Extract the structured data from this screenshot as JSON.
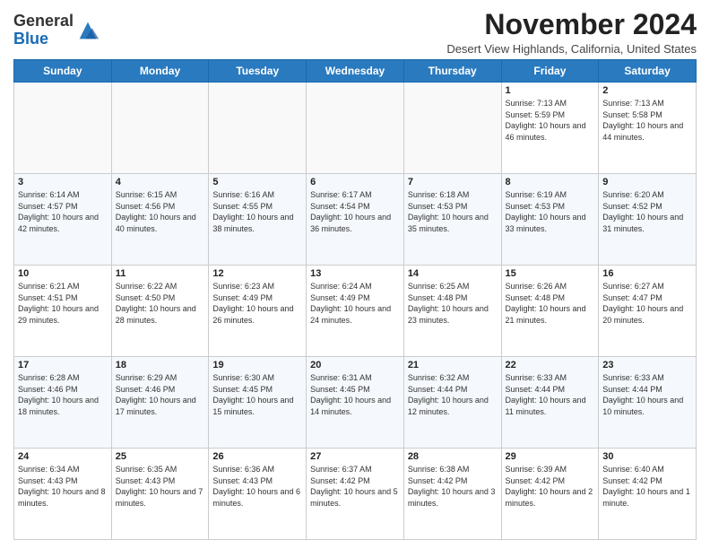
{
  "logo": {
    "general": "General",
    "blue": "Blue"
  },
  "header": {
    "title": "November 2024",
    "subtitle": "Desert View Highlands, California, United States"
  },
  "days_of_week": [
    "Sunday",
    "Monday",
    "Tuesday",
    "Wednesday",
    "Thursday",
    "Friday",
    "Saturday"
  ],
  "weeks": [
    [
      {
        "day": "",
        "sunrise": "",
        "sunset": "",
        "daylight": ""
      },
      {
        "day": "",
        "sunrise": "",
        "sunset": "",
        "daylight": ""
      },
      {
        "day": "",
        "sunrise": "",
        "sunset": "",
        "daylight": ""
      },
      {
        "day": "",
        "sunrise": "",
        "sunset": "",
        "daylight": ""
      },
      {
        "day": "",
        "sunrise": "",
        "sunset": "",
        "daylight": ""
      },
      {
        "day": "1",
        "sunrise": "Sunrise: 7:13 AM",
        "sunset": "Sunset: 5:59 PM",
        "daylight": "Daylight: 10 hours and 46 minutes."
      },
      {
        "day": "2",
        "sunrise": "Sunrise: 7:13 AM",
        "sunset": "Sunset: 5:58 PM",
        "daylight": "Daylight: 10 hours and 44 minutes."
      }
    ],
    [
      {
        "day": "3",
        "sunrise": "Sunrise: 6:14 AM",
        "sunset": "Sunset: 4:57 PM",
        "daylight": "Daylight: 10 hours and 42 minutes."
      },
      {
        "day": "4",
        "sunrise": "Sunrise: 6:15 AM",
        "sunset": "Sunset: 4:56 PM",
        "daylight": "Daylight: 10 hours and 40 minutes."
      },
      {
        "day": "5",
        "sunrise": "Sunrise: 6:16 AM",
        "sunset": "Sunset: 4:55 PM",
        "daylight": "Daylight: 10 hours and 38 minutes."
      },
      {
        "day": "6",
        "sunrise": "Sunrise: 6:17 AM",
        "sunset": "Sunset: 4:54 PM",
        "daylight": "Daylight: 10 hours and 36 minutes."
      },
      {
        "day": "7",
        "sunrise": "Sunrise: 6:18 AM",
        "sunset": "Sunset: 4:53 PM",
        "daylight": "Daylight: 10 hours and 35 minutes."
      },
      {
        "day": "8",
        "sunrise": "Sunrise: 6:19 AM",
        "sunset": "Sunset: 4:53 PM",
        "daylight": "Daylight: 10 hours and 33 minutes."
      },
      {
        "day": "9",
        "sunrise": "Sunrise: 6:20 AM",
        "sunset": "Sunset: 4:52 PM",
        "daylight": "Daylight: 10 hours and 31 minutes."
      }
    ],
    [
      {
        "day": "10",
        "sunrise": "Sunrise: 6:21 AM",
        "sunset": "Sunset: 4:51 PM",
        "daylight": "Daylight: 10 hours and 29 minutes."
      },
      {
        "day": "11",
        "sunrise": "Sunrise: 6:22 AM",
        "sunset": "Sunset: 4:50 PM",
        "daylight": "Daylight: 10 hours and 28 minutes."
      },
      {
        "day": "12",
        "sunrise": "Sunrise: 6:23 AM",
        "sunset": "Sunset: 4:49 PM",
        "daylight": "Daylight: 10 hours and 26 minutes."
      },
      {
        "day": "13",
        "sunrise": "Sunrise: 6:24 AM",
        "sunset": "Sunset: 4:49 PM",
        "daylight": "Daylight: 10 hours and 24 minutes."
      },
      {
        "day": "14",
        "sunrise": "Sunrise: 6:25 AM",
        "sunset": "Sunset: 4:48 PM",
        "daylight": "Daylight: 10 hours and 23 minutes."
      },
      {
        "day": "15",
        "sunrise": "Sunrise: 6:26 AM",
        "sunset": "Sunset: 4:48 PM",
        "daylight": "Daylight: 10 hours and 21 minutes."
      },
      {
        "day": "16",
        "sunrise": "Sunrise: 6:27 AM",
        "sunset": "Sunset: 4:47 PM",
        "daylight": "Daylight: 10 hours and 20 minutes."
      }
    ],
    [
      {
        "day": "17",
        "sunrise": "Sunrise: 6:28 AM",
        "sunset": "Sunset: 4:46 PM",
        "daylight": "Daylight: 10 hours and 18 minutes."
      },
      {
        "day": "18",
        "sunrise": "Sunrise: 6:29 AM",
        "sunset": "Sunset: 4:46 PM",
        "daylight": "Daylight: 10 hours and 17 minutes."
      },
      {
        "day": "19",
        "sunrise": "Sunrise: 6:30 AM",
        "sunset": "Sunset: 4:45 PM",
        "daylight": "Daylight: 10 hours and 15 minutes."
      },
      {
        "day": "20",
        "sunrise": "Sunrise: 6:31 AM",
        "sunset": "Sunset: 4:45 PM",
        "daylight": "Daylight: 10 hours and 14 minutes."
      },
      {
        "day": "21",
        "sunrise": "Sunrise: 6:32 AM",
        "sunset": "Sunset: 4:44 PM",
        "daylight": "Daylight: 10 hours and 12 minutes."
      },
      {
        "day": "22",
        "sunrise": "Sunrise: 6:33 AM",
        "sunset": "Sunset: 4:44 PM",
        "daylight": "Daylight: 10 hours and 11 minutes."
      },
      {
        "day": "23",
        "sunrise": "Sunrise: 6:33 AM",
        "sunset": "Sunset: 4:44 PM",
        "daylight": "Daylight: 10 hours and 10 minutes."
      }
    ],
    [
      {
        "day": "24",
        "sunrise": "Sunrise: 6:34 AM",
        "sunset": "Sunset: 4:43 PM",
        "daylight": "Daylight: 10 hours and 8 minutes."
      },
      {
        "day": "25",
        "sunrise": "Sunrise: 6:35 AM",
        "sunset": "Sunset: 4:43 PM",
        "daylight": "Daylight: 10 hours and 7 minutes."
      },
      {
        "day": "26",
        "sunrise": "Sunrise: 6:36 AM",
        "sunset": "Sunset: 4:43 PM",
        "daylight": "Daylight: 10 hours and 6 minutes."
      },
      {
        "day": "27",
        "sunrise": "Sunrise: 6:37 AM",
        "sunset": "Sunset: 4:42 PM",
        "daylight": "Daylight: 10 hours and 5 minutes."
      },
      {
        "day": "28",
        "sunrise": "Sunrise: 6:38 AM",
        "sunset": "Sunset: 4:42 PM",
        "daylight": "Daylight: 10 hours and 3 minutes."
      },
      {
        "day": "29",
        "sunrise": "Sunrise: 6:39 AM",
        "sunset": "Sunset: 4:42 PM",
        "daylight": "Daylight: 10 hours and 2 minutes."
      },
      {
        "day": "30",
        "sunrise": "Sunrise: 6:40 AM",
        "sunset": "Sunset: 4:42 PM",
        "daylight": "Daylight: 10 hours and 1 minute."
      }
    ]
  ]
}
